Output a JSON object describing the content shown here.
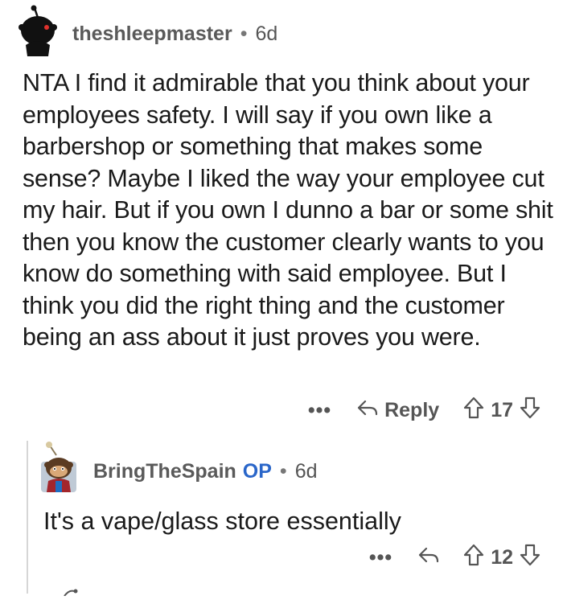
{
  "comment": {
    "username": "theshleepmaster",
    "separator": "•",
    "age": "6d",
    "avatar_icon": "snoo-avatar-icon",
    "body": "NTA I find it admirable that you think about your employees safety. I will say if you own like a barbershop or something that makes some sense? Maybe I liked the way your employee cut my hair. But if you own I dunno a bar or some shit then you know the customer clearly wants to you know do something with said employee. But I think you did the right thing and the customer being an ass about it just proves you were.",
    "actions": {
      "more": "•••",
      "reply_label": "Reply",
      "vote_count": "17"
    }
  },
  "reply": {
    "username": "BringTheSpain",
    "op_badge": "OP",
    "separator": "•",
    "age": "6d",
    "avatar_icon": "op-avatar-icon",
    "body": "It's a vape/glass store essentially",
    "actions": {
      "more": "•••",
      "vote_count": "12"
    }
  },
  "colors": {
    "text": "#1a1a1a",
    "meta": "#555555",
    "op_badge": "#2a66c9",
    "thread_line": "#d6d6d6"
  }
}
